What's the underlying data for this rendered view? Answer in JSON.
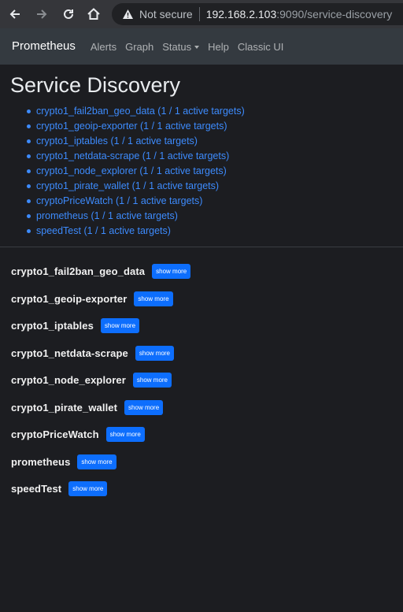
{
  "browser": {
    "security_label": "Not secure",
    "url_host": "192.168.2.103",
    "url_path": ":9090/service-discovery"
  },
  "navbar": {
    "brand": "Prometheus",
    "links": [
      "Alerts",
      "Graph",
      "Status",
      "Help",
      "Classic UI"
    ]
  },
  "page": {
    "title": "Service Discovery"
  },
  "targets": [
    "crypto1_fail2ban_geo_data (1 / 1 active targets)",
    "crypto1_geoip-exporter (1 / 1 active targets)",
    "crypto1_iptables (1 / 1 active targets)",
    "crypto1_netdata-scrape (1 / 1 active targets)",
    "crypto1_node_explorer (1 / 1 active targets)",
    "crypto1_pirate_wallet (1 / 1 active targets)",
    "cryptoPriceWatch (1 / 1 active targets)",
    "prometheus (1 / 1 active targets)",
    "speedTest (1 / 1 active targets)"
  ],
  "jobs": [
    "crypto1_fail2ban_geo_data",
    "crypto1_geoip-exporter",
    "crypto1_iptables",
    "crypto1_netdata-scrape",
    "crypto1_node_explorer",
    "crypto1_pirate_wallet",
    "cryptoPriceWatch",
    "prometheus",
    "speedTest"
  ],
  "show_more_label": "show more",
  "colors": {
    "link": "#3d8bfd",
    "button": "#0d6efd",
    "navbar": "#343a40",
    "background": "#1c1d21"
  }
}
